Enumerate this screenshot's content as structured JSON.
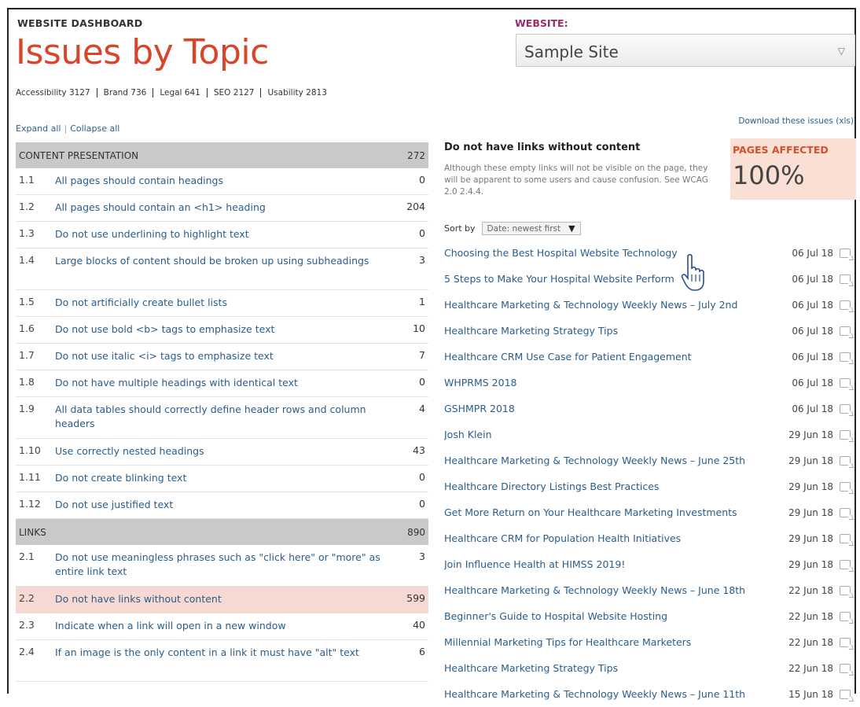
{
  "header": {
    "eyebrow": "WEBSITE DASHBOARD",
    "title": "Issues by Topic",
    "topics": [
      {
        "label": "Accessibility 3127"
      },
      {
        "label": "Brand 736"
      },
      {
        "label": "Legal 641"
      },
      {
        "label": "SEO 2127"
      },
      {
        "label": "Usability 2813"
      }
    ],
    "website_label": "WEBSITE:",
    "website_value": "Sample Site"
  },
  "controls": {
    "expand_all": "Expand all",
    "collapse_all": "Collapse all",
    "separator": "|",
    "download": "Download these issues (xls)"
  },
  "sections": [
    {
      "name": "CONTENT PRESENTATION",
      "count": "272",
      "items": [
        {
          "num": "1.1",
          "label": "All pages should contain headings",
          "count": "0"
        },
        {
          "num": "1.2",
          "label": "All pages should contain an <h1> heading",
          "count": "204"
        },
        {
          "num": "1.3",
          "label": "Do not use underlining to highlight text",
          "count": "0"
        },
        {
          "num": "1.4",
          "label": "Large blocks of content should be broken up using subheadings",
          "count": "3"
        },
        {
          "num": "1.5",
          "label": "Do not artificially create bullet lists",
          "count": "1"
        },
        {
          "num": "1.6",
          "label": "Do not use bold <b> tags to emphasize text",
          "count": "10"
        },
        {
          "num": "1.7",
          "label": "Do not use italic <i> tags to emphasize text",
          "count": "7"
        },
        {
          "num": "1.8",
          "label": "Do not have multiple headings with identical text",
          "count": "0"
        },
        {
          "num": "1.9",
          "label": "All data tables should correctly define header rows and column headers",
          "count": "4"
        },
        {
          "num": "1.10",
          "label": "Use correctly nested headings",
          "count": "43"
        },
        {
          "num": "1.11",
          "label": "Do not create blinking text",
          "count": "0"
        },
        {
          "num": "1.12",
          "label": "Do not use justified text",
          "count": "0"
        }
      ]
    },
    {
      "name": "LINKS",
      "count": "890",
      "items": [
        {
          "num": "2.1",
          "label": "Do not use meaningless phrases such as \"click here\" or \"more\" as entire link text",
          "count": "3"
        },
        {
          "num": "2.2",
          "label": "Do not have links without content",
          "count": "599",
          "selected": true
        },
        {
          "num": "2.3",
          "label": "Indicate when a link will open in a new window",
          "count": "40"
        },
        {
          "num": "2.4",
          "label": "If an image is the only content in a link it must have \"alt\" text",
          "count": "6"
        }
      ]
    }
  ],
  "issue": {
    "title": "Do not have links without content",
    "description": "Although these empty links will not be visible on the page, they will be apparent to some users and cause confusion. See WCAG 2.0 2.4.4.",
    "affected_label": "PAGES AFFECTED",
    "affected_value": "100%",
    "sort_label": "Sort by",
    "sort_value": "Date: newest first"
  },
  "pages": [
    {
      "title": "Choosing the Best Hospital Website Technology",
      "date": "06 Jul 18"
    },
    {
      "title": "5 Steps to Make Your Hospital Website Perform",
      "date": "06 Jul 18"
    },
    {
      "title": "Healthcare Marketing & Technology Weekly News – July 2nd",
      "date": "06 Jul 18"
    },
    {
      "title": "Healthcare Marketing Strategy Tips",
      "date": "06 Jul 18"
    },
    {
      "title": "Healthcare CRM Use Case for Patient Engagement",
      "date": "06 Jul 18"
    },
    {
      "title": "WHPRMS 2018",
      "date": "06 Jul 18"
    },
    {
      "title": "GSHMPR 2018",
      "date": "06 Jul 18"
    },
    {
      "title": "Josh Klein",
      "date": "29 Jun 18"
    },
    {
      "title": "Healthcare Marketing & Technology Weekly News – June 25th",
      "date": "29 Jun 18"
    },
    {
      "title": "Healthcare Directory Listings Best Practices",
      "date": "29 Jun 18"
    },
    {
      "title": "Get More Return on Your Healthcare Marketing Investments",
      "date": "29 Jun 18"
    },
    {
      "title": "Healthcare CRM for Population Health Initiatives",
      "date": "29 Jun 18"
    },
    {
      "title": "Join Influence Health at HIMSS 2019!",
      "date": "29 Jun 18"
    },
    {
      "title": "Healthcare Marketing & Technology Weekly News – June 18th",
      "date": "22 Jun 18"
    },
    {
      "title": "Beginner's Guide to Hospital Website Hosting",
      "date": "22 Jun 18"
    },
    {
      "title": "Millennial Marketing Tips for Healthcare Marketers",
      "date": "22 Jun 18"
    },
    {
      "title": "Healthcare Marketing Strategy Tips",
      "date": "22 Jun 18"
    },
    {
      "title": "Healthcare Marketing & Technology Weekly News – June 11th",
      "date": "15 Jun 18"
    }
  ],
  "colors": {
    "accent": "#d9452b",
    "link": "#2a5d8a",
    "website_label": "#9b2a6a",
    "selected_row": "#f7d9d3",
    "affected_bg": "#fadfd4"
  },
  "icons": {
    "select_chevron": "chevron-down-icon",
    "sort_arrow": "triangle-down-icon",
    "comment": "comment-icon",
    "cursor": "hand-pointer-icon"
  }
}
